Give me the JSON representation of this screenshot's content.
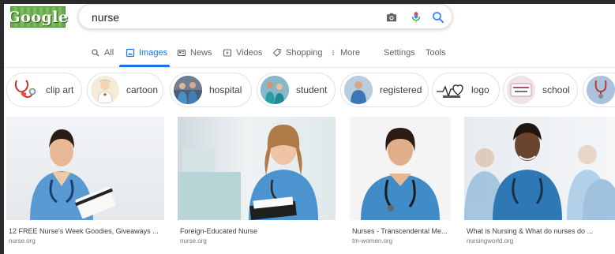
{
  "logo": {
    "text": "Google"
  },
  "search": {
    "query": "nurse"
  },
  "tabs": [
    {
      "label": "All",
      "icon": "search-icon"
    },
    {
      "label": "Images",
      "icon": "image-icon",
      "active": true
    },
    {
      "label": "News",
      "icon": "news-icon"
    },
    {
      "label": "Videos",
      "icon": "video-icon"
    },
    {
      "label": "Shopping",
      "icon": "tag-icon"
    },
    {
      "label": "More",
      "icon": "more-vert-icon"
    },
    {
      "label": "Settings"
    },
    {
      "label": "Tools"
    }
  ],
  "chips": [
    {
      "label": "clip art"
    },
    {
      "label": "cartoon"
    },
    {
      "label": "hospital"
    },
    {
      "label": "student"
    },
    {
      "label": "registered"
    },
    {
      "label": "logo"
    },
    {
      "label": "school"
    }
  ],
  "results": [
    {
      "title": "12 FREE Nurse's Week Goodies, Giveaways ...",
      "source": "nurse.org"
    },
    {
      "title": "Foreign-Educated Nurse",
      "source": "nurse.org"
    },
    {
      "title": "Nurses - Transcendental Me...",
      "source": "tm-women.org"
    },
    {
      "title": "What is Nursing & What do nurses do ...",
      "source": "nursingworld.org"
    }
  ],
  "colors": {
    "accent": "#1a73e8",
    "scrub_blue": "#4a90c8",
    "frame": "#2b2b2b"
  }
}
